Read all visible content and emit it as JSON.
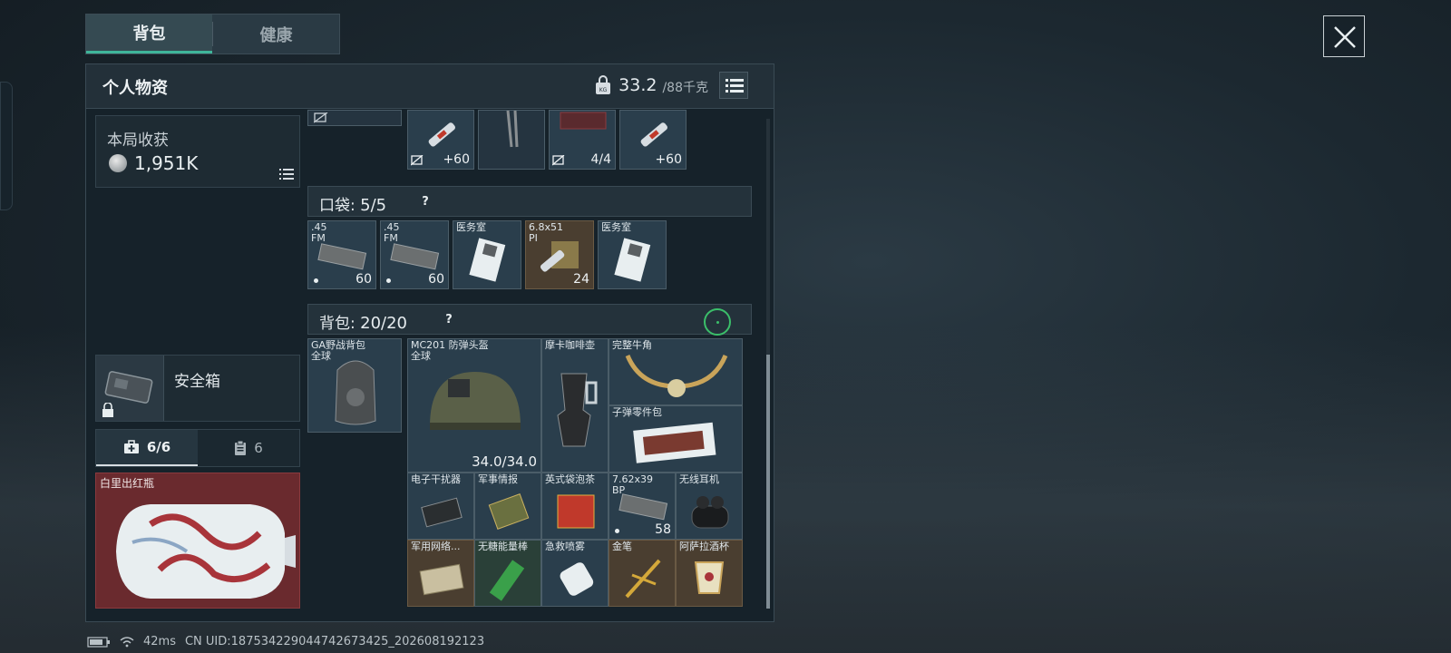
{
  "tabs": {
    "backpack": "背包",
    "health": "健康"
  },
  "panel": {
    "title": "个人物资",
    "weight_current": "33.2",
    "weight_max": "/88千克"
  },
  "harvest": {
    "label": "本局收获",
    "value": "1,951K"
  },
  "safebox": {
    "label": "安全箱"
  },
  "pouch_tabs": {
    "medkit": "6/6",
    "clipboard": "6"
  },
  "vase": {
    "label": "白里出红瓶"
  },
  "top_slots": [
    {
      "count": "+60"
    },
    {
      "count": ""
    },
    {
      "count": "4/4"
    },
    {
      "count": "+60"
    }
  ],
  "pocket": {
    "label": "口袋:",
    "count": "5/5",
    "items": [
      {
        "name": ".45\nFM",
        "count": "60"
      },
      {
        "name": ".45\nFM",
        "count": "60"
      },
      {
        "name": "医务室",
        "count": ""
      },
      {
        "name": "6.8x51\nPI",
        "count": "24"
      },
      {
        "name": "医务室",
        "count": ""
      }
    ]
  },
  "backpack": {
    "label": "背包:",
    "count": "20/20",
    "rig_name": "GA野战背包\n全球",
    "helmet_name": "MC201 防弹头盔\n全球",
    "helmet_durability": "34.0/34.0",
    "coffee_pot": "摩卡咖啡壶",
    "horn": "完整牛角",
    "ammo_box": "子弹零件包",
    "jammer": "电子干扰器",
    "intel": "军事情报",
    "tea": "英式袋泡茶",
    "ammo_762": "7.62x39\nBP",
    "ammo_762_count": "58",
    "earbuds": "无线耳机",
    "router": "军用网络...",
    "energy_bar": "无糖能量棒",
    "spray": "急救喷雾",
    "pen": "金笔",
    "cup": "阿萨拉酒杯"
  },
  "status": {
    "ping": "42ms",
    "uid": "CN UID:18753422904474267342​5_202608192123"
  }
}
